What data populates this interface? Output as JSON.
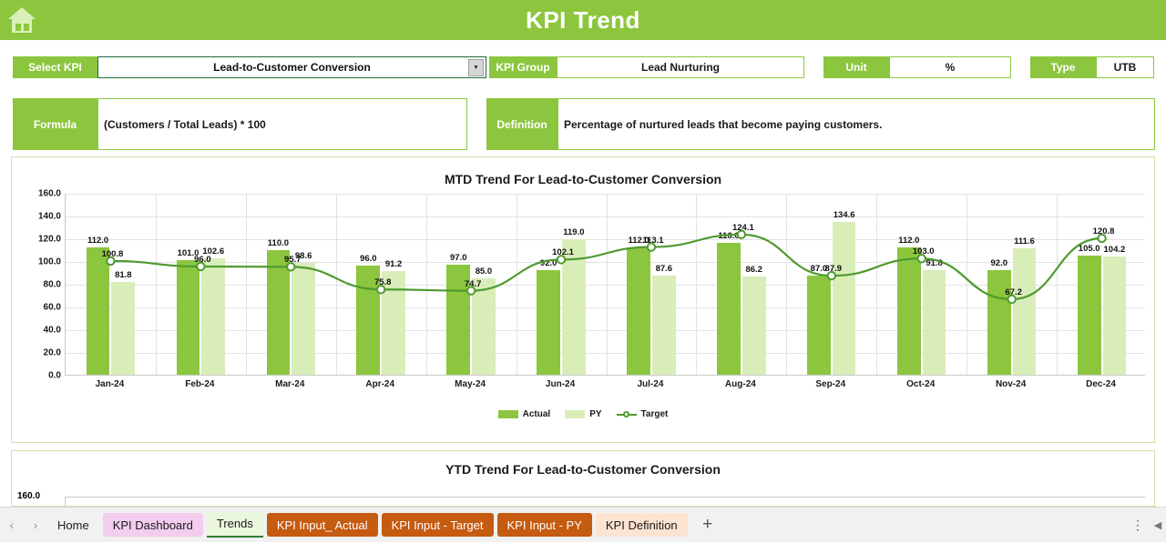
{
  "app": {
    "title": "KPI Trend",
    "home_icon": "home-icon"
  },
  "fields": {
    "select_kpi_label": "Select KPI",
    "select_kpi_value": "Lead-to-Customer Conversion",
    "kpi_group_label": "KPI Group",
    "kpi_group_value": "Lead Nurturing",
    "unit_label": "Unit",
    "unit_value": "%",
    "type_label": "Type",
    "type_value": "UTB",
    "formula_label": "Formula",
    "formula_value": "(Customers / Total Leads) * 100",
    "definition_label": "Definition",
    "definition_value": "Percentage of nurtured leads that become paying customers."
  },
  "ytd": {
    "title": "YTD Trend For Lead-to-Customer Conversion",
    "first_ytick": "160.0"
  },
  "sheet_tabs": {
    "prev_label": "‹",
    "next_label": "›",
    "add_label": "+",
    "menu_label": "⋮",
    "items": [
      {
        "label": "Home",
        "style": "plain"
      },
      {
        "label": "KPI Dashboard",
        "style": "pink"
      },
      {
        "label": "Trends",
        "style": "active"
      },
      {
        "label": "KPI Input_ Actual",
        "style": "orange"
      },
      {
        "label": "KPI Input - Target",
        "style": "orange"
      },
      {
        "label": "KPI Input - PY",
        "style": "orange"
      },
      {
        "label": "KPI Definition",
        "style": "peach"
      }
    ]
  },
  "colors": {
    "brand_green": "#8CC63E",
    "actual": "#8CC63E",
    "py": "#d9edb9",
    "target_line": "#4e9a2f",
    "orange_tab": "#c55a11",
    "pink_tab": "#f3cdee"
  },
  "chart_data": {
    "type": "bar",
    "title": "MTD Trend For Lead-to-Customer Conversion",
    "xlabel": "",
    "ylabel": "",
    "ylim": [
      0,
      160
    ],
    "yticks": [
      "0.0",
      "20.0",
      "40.0",
      "60.0",
      "80.0",
      "100.0",
      "120.0",
      "140.0",
      "160.0"
    ],
    "grid": true,
    "legend_position": "bottom",
    "categories": [
      "Jan-24",
      "Feb-24",
      "Mar-24",
      "Apr-24",
      "May-24",
      "Jun-24",
      "Jul-24",
      "Aug-24",
      "Sep-24",
      "Oct-24",
      "Nov-24",
      "Dec-24"
    ],
    "series": [
      {
        "name": "Actual",
        "type": "bar",
        "values": [
          112.0,
          101.0,
          110.0,
          96.0,
          97.0,
          92.0,
          112.0,
          116.0,
          87.0,
          112.0,
          92.0,
          105.0
        ]
      },
      {
        "name": "PY",
        "type": "bar",
        "values": [
          81.8,
          102.6,
          98.6,
          91.2,
          85.0,
          119.0,
          87.6,
          86.2,
          134.6,
          91.8,
          111.6,
          104.2
        ]
      },
      {
        "name": "Target",
        "type": "line",
        "values": [
          100.8,
          96.0,
          95.7,
          75.8,
          74.7,
          102.1,
          113.1,
          124.1,
          87.9,
          103.0,
          67.2,
          120.8
        ]
      }
    ]
  }
}
